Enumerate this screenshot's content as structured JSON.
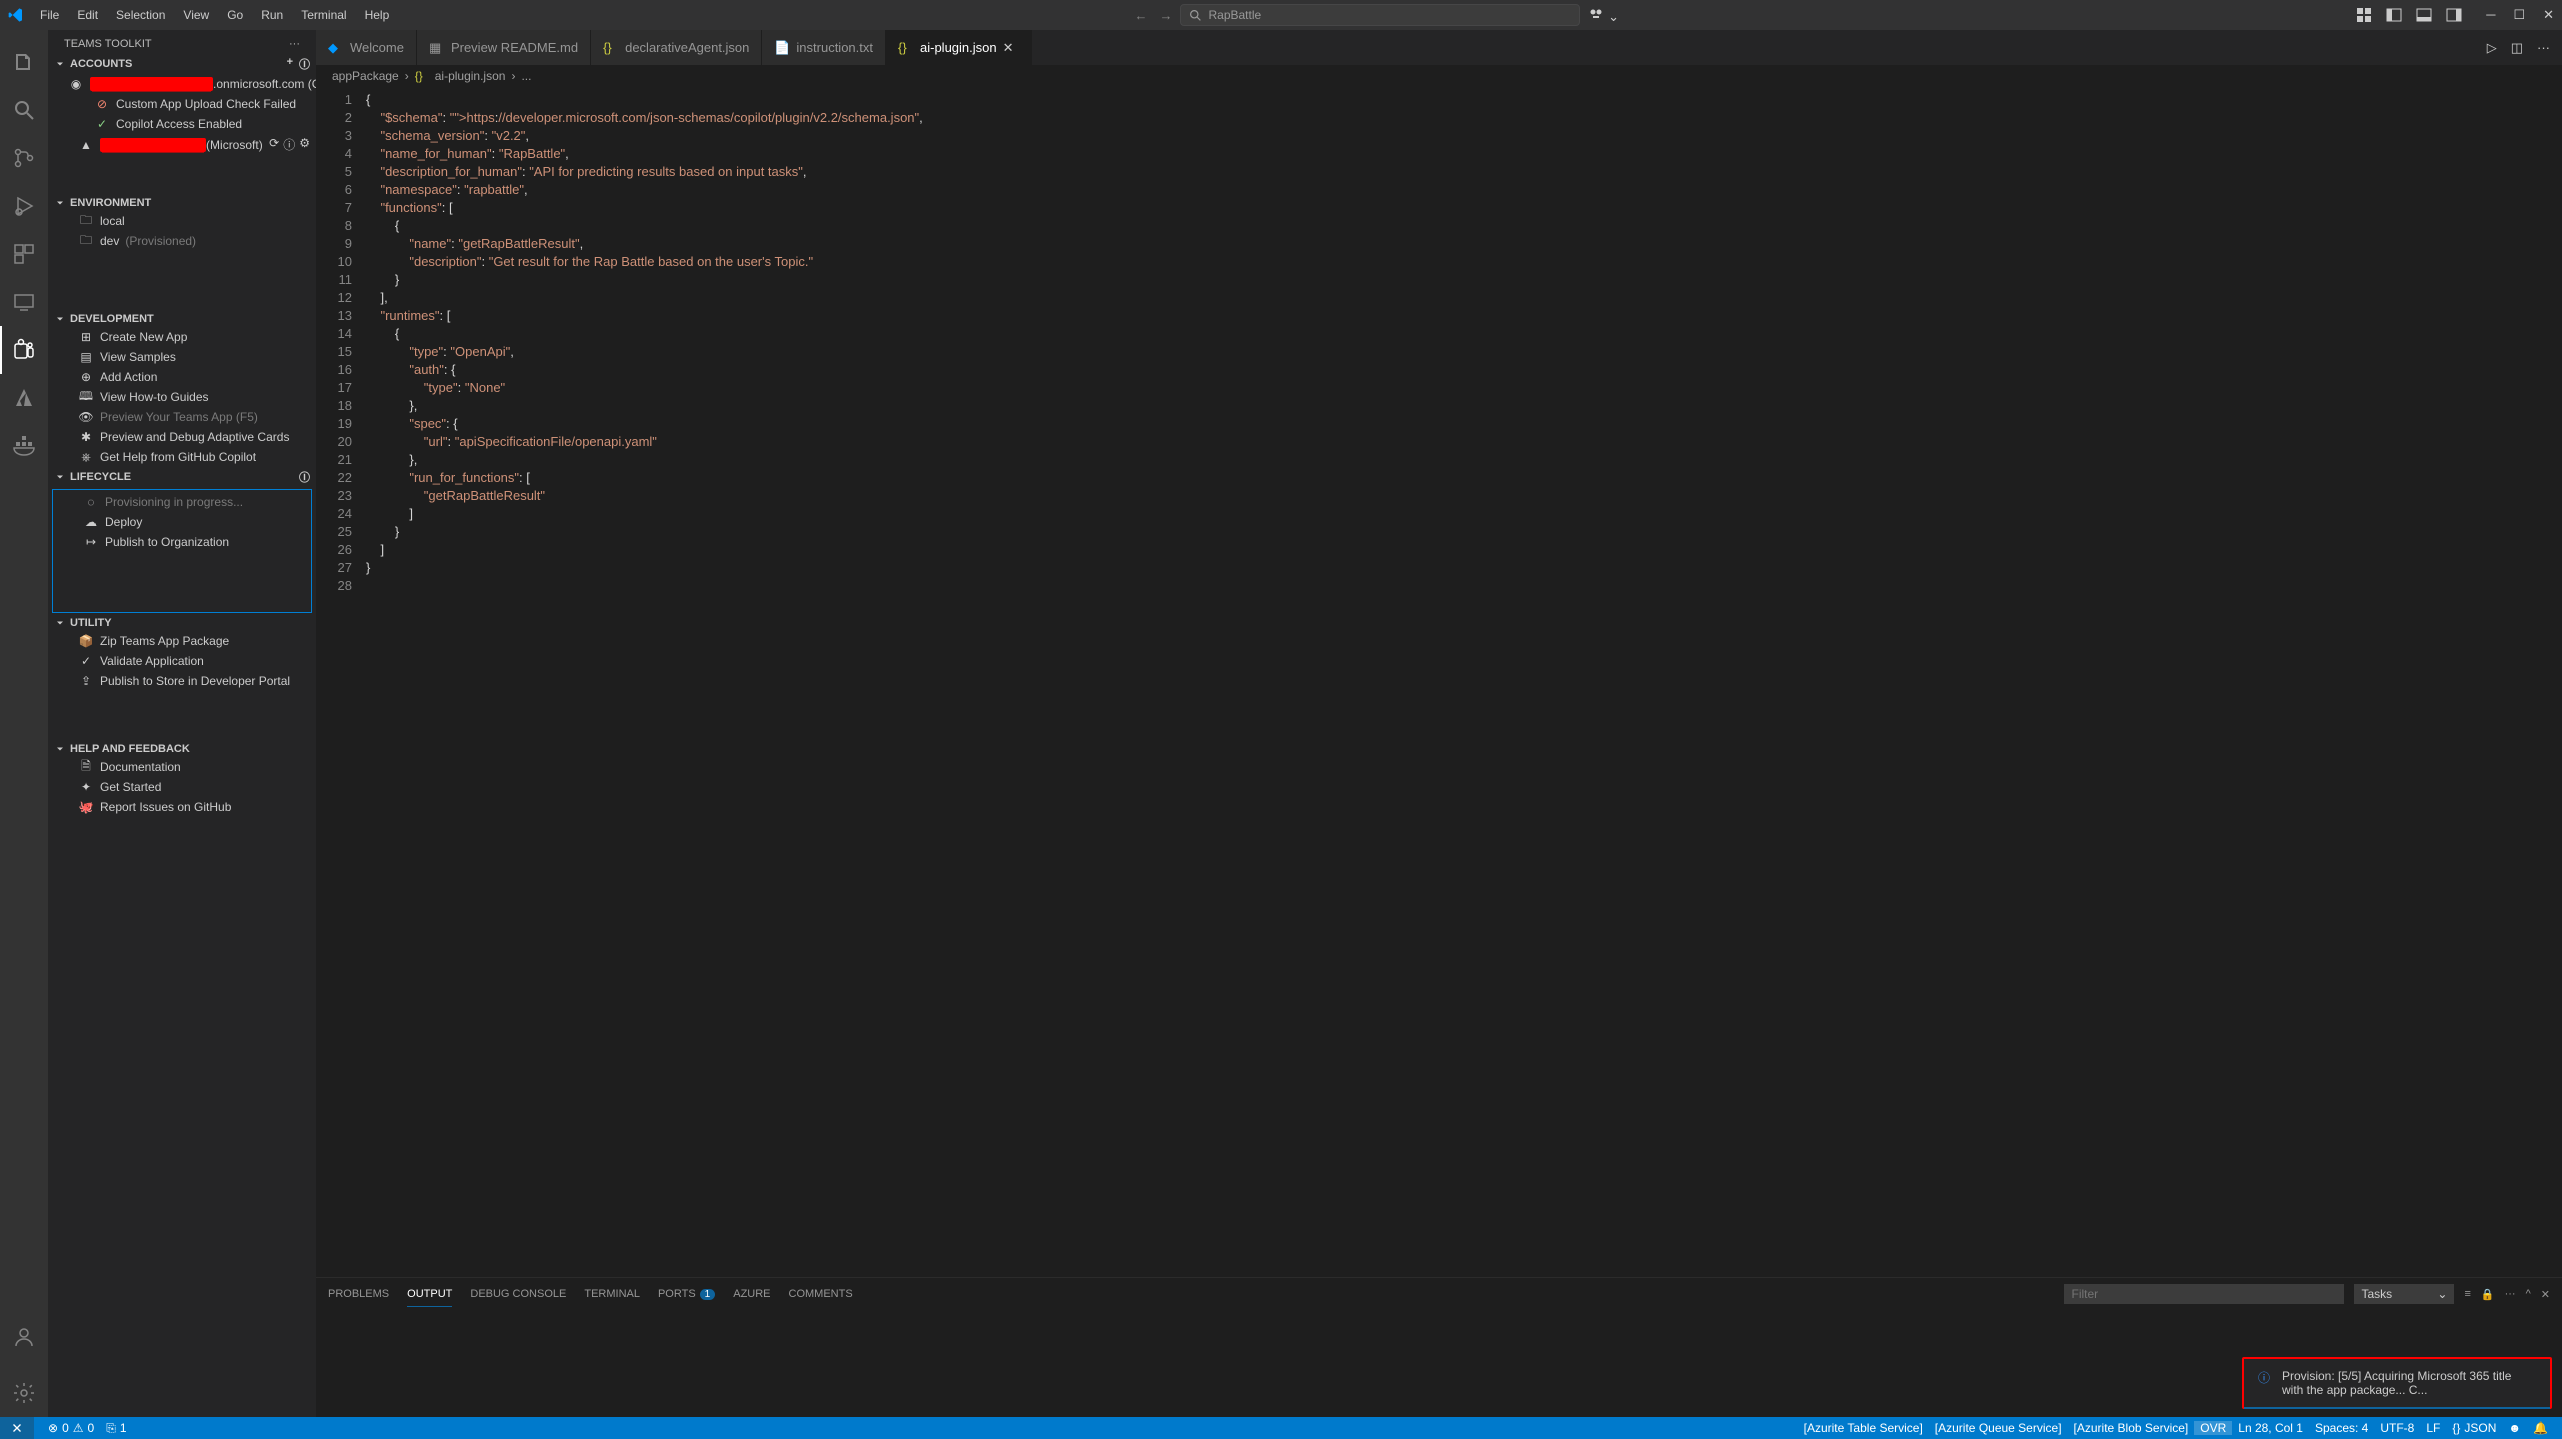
{
  "menu": [
    "File",
    "Edit",
    "Selection",
    "View",
    "Go",
    "Run",
    "Terminal",
    "Help"
  ],
  "search_placeholder": "RapBattle",
  "sidebar_title": "TEAMS TOOLKIT",
  "accounts": {
    "title": "ACCOUNTS",
    "item1_suffix": ".onmicrosoft.com (Contoso)",
    "custom_app": "Custom App Upload Check Failed",
    "copilot": "Copilot Access Enabled",
    "item2_suffix": "(Microsoft)"
  },
  "environment": {
    "title": "ENVIRONMENT",
    "local": "local",
    "dev": "dev",
    "dev_status": "(Provisioned)"
  },
  "development": {
    "title": "DEVELOPMENT",
    "items": [
      "Create New App",
      "View Samples",
      "Add Action",
      "View How-to Guides",
      "Preview Your Teams App (F5)",
      "Preview and Debug Adaptive Cards",
      "Get Help from GitHub Copilot"
    ]
  },
  "lifecycle": {
    "title": "LIFECYCLE",
    "provisioning": "Provisioning in progress...",
    "deploy": "Deploy",
    "publish": "Publish to Organization"
  },
  "utility": {
    "title": "UTILITY",
    "items": [
      "Zip Teams App Package",
      "Validate Application",
      "Publish to Store in Developer Portal"
    ]
  },
  "help": {
    "title": "HELP AND FEEDBACK",
    "items": [
      "Documentation",
      "Get Started",
      "Report Issues on GitHub"
    ]
  },
  "tabs": [
    {
      "label": "Welcome",
      "active": false
    },
    {
      "label": "Preview README.md",
      "active": false
    },
    {
      "label": "declarativeAgent.json",
      "active": false
    },
    {
      "label": "instruction.txt",
      "active": false
    },
    {
      "label": "ai-plugin.json",
      "active": true
    }
  ],
  "breadcrumb": {
    "folder": "appPackage",
    "file": "ai-plugin.json",
    "more": "..."
  },
  "code_lines": [
    "{",
    "    \"$schema\": \"https://developer.microsoft.com/json-schemas/copilot/plugin/v2.2/schema.json\",",
    "    \"schema_version\": \"v2.2\",",
    "    \"name_for_human\": \"RapBattle\",",
    "    \"description_for_human\": \"API for predicting results based on input tasks\",",
    "    \"namespace\": \"rapbattle\",",
    "    \"functions\": [",
    "        {",
    "            \"name\": \"getRapBattleResult\",",
    "            \"description\": \"Get result for the Rap Battle based on the user's Topic.\"",
    "        }",
    "    ],",
    "    \"runtimes\": [",
    "        {",
    "            \"type\": \"OpenApi\",",
    "            \"auth\": {",
    "                \"type\": \"None\"",
    "            },",
    "            \"spec\": {",
    "                \"url\": \"apiSpecificationFile/openapi.yaml\"",
    "            },",
    "            \"run_for_functions\": [",
    "                \"getRapBattleResult\"",
    "            ]",
    "        }",
    "    ]",
    "}",
    ""
  ],
  "panel": {
    "tabs": [
      "PROBLEMS",
      "OUTPUT",
      "DEBUG CONSOLE",
      "TERMINAL",
      "PORTS",
      "AZURE",
      "COMMENTS"
    ],
    "ports_badge": "1",
    "filter_placeholder": "Filter",
    "select_label": "Tasks"
  },
  "toast": "Provision: [5/5] Acquiring Microsoft 365 title with the app package... C...",
  "status": {
    "errors": "0",
    "warnings": "0",
    "ports": "1",
    "azurite_table": "[Azurite Table Service]",
    "azurite_queue": "[Azurite Queue Service]",
    "azurite_blob": "[Azurite Blob Service]",
    "ovr": "OVR",
    "pos": "Ln 28, Col 1",
    "spaces": "Spaces: 4",
    "encoding": "UTF-8",
    "eol": "LF",
    "lang": "JSON"
  }
}
